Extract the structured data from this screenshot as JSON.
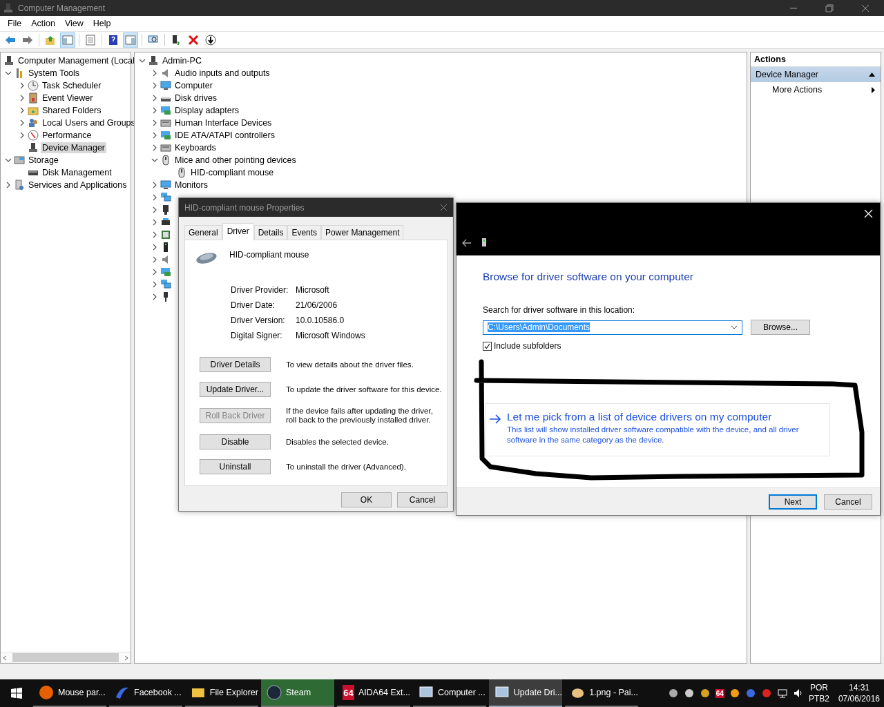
{
  "window": {
    "title": "Computer Management"
  },
  "menu": [
    "File",
    "Action",
    "View",
    "Help"
  ],
  "toolbar": [
    {
      "pressed": false
    },
    {
      "pressed": false
    },
    {
      "pressed": false
    },
    {
      "pressed": true
    },
    {
      "pressed": false
    },
    {
      "pressed": false
    },
    {
      "pressed": true
    },
    {
      "pressed": false
    },
    {
      "pressed": false
    },
    {
      "pressed": false
    },
    {
      "pressed": false
    }
  ],
  "console_tree": {
    "root": "Computer Management (Local",
    "children": [
      {
        "label": "System Tools",
        "expanded": true,
        "selected": false,
        "children": [
          {
            "label": "Task Scheduler",
            "expanded": false,
            "selected": false
          },
          {
            "label": "Event Viewer",
            "expanded": false,
            "selected": false
          },
          {
            "label": "Shared Folders",
            "expanded": false,
            "selected": false
          },
          {
            "label": "Local Users and Groups",
            "expanded": false,
            "selected": false
          },
          {
            "label": "Performance",
            "expanded": false,
            "selected": false
          },
          {
            "label": "Device Manager",
            "selected": true
          }
        ]
      },
      {
        "label": "Storage",
        "expanded": true,
        "selected": false,
        "children": [
          {
            "label": "Disk Management",
            "selected": false
          }
        ]
      },
      {
        "label": "Services and Applications",
        "expanded": false,
        "selected": false
      }
    ]
  },
  "device_tree": {
    "root": "Admin-PC",
    "expanded": true,
    "children": [
      {
        "label": "Audio inputs and outputs",
        "expanded": false
      },
      {
        "label": "Computer",
        "expanded": false
      },
      {
        "label": "Disk drives",
        "expanded": false
      },
      {
        "label": "Display adapters",
        "expanded": false
      },
      {
        "label": "Human Interface Devices",
        "expanded": false
      },
      {
        "label": "IDE ATA/ATAPI controllers",
        "expanded": false
      },
      {
        "label": "Keyboards",
        "expanded": false
      },
      {
        "label": "Mice and other pointing devices",
        "expanded": true,
        "children": [
          {
            "label": "HID-compliant mouse"
          }
        ]
      },
      {
        "label": "Monitors",
        "expanded": false
      },
      {
        "expanded": false
      },
      {
        "expanded": false
      },
      {
        "expanded": false
      },
      {
        "expanded": false
      },
      {
        "expanded": false
      },
      {
        "expanded": false
      },
      {
        "expanded": false
      },
      {
        "expanded": false
      },
      {
        "expanded": false
      }
    ]
  },
  "actions": {
    "title": "Actions",
    "section": {
      "label": "Device Manager",
      "expanded": true
    },
    "items": [
      "More Actions"
    ]
  },
  "properties_dialog": {
    "title": "HID-compliant mouse Properties",
    "tabs": [
      {
        "label": "General",
        "selected": false
      },
      {
        "label": "Driver",
        "selected": true
      },
      {
        "label": "Details",
        "selected": false
      },
      {
        "label": "Events",
        "selected": false
      },
      {
        "label": "Power Management",
        "selected": false
      }
    ],
    "device_name": "HID-compliant mouse",
    "info": [
      {
        "label": "Driver Provider:",
        "value": "Microsoft"
      },
      {
        "label": "Driver Date:",
        "value": "21/06/2006"
      },
      {
        "label": "Driver Version:",
        "value": "10.0.10586.0"
      },
      {
        "label": "Digital Signer:",
        "value": "Microsoft Windows"
      }
    ],
    "actions": [
      {
        "button": "Driver Details",
        "disabled": false,
        "description": "To view details about the driver files."
      },
      {
        "button": "Update Driver...",
        "disabled": false,
        "description": "To update the driver software for this device."
      },
      {
        "button": "Roll Back Driver",
        "disabled": true,
        "description": "If the device fails after updating the driver, roll back to the previously installed driver."
      },
      {
        "button": "Disable",
        "disabled": false,
        "description": "Disables the selected device."
      },
      {
        "button": "Uninstall",
        "disabled": false,
        "description": "To uninstall the driver (Advanced)."
      }
    ],
    "buttons": [
      "OK",
      "Cancel"
    ]
  },
  "update_wizard": {
    "heading": "Browse for driver software on your computer",
    "location_label": "Search for driver software in this location:",
    "location_value": "C:\\Users\\Admin\\Documents",
    "browse_button": "Browse...",
    "include_subfolders": {
      "label": "Include subfolders",
      "checked": true
    },
    "pick_option": {
      "title": "Let me pick from a list of device drivers on my computer",
      "description": "This list will show installed driver software compatible with the device, and all driver software in the same category as the device."
    },
    "buttons": [
      {
        "label": "Next",
        "default": true
      },
      {
        "label": "Cancel",
        "default": false
      }
    ]
  },
  "taskbar": {
    "items": [
      {
        "label": "Mouse par...",
        "selected": false,
        "flashing": false
      },
      {
        "label": "Facebook ...",
        "selected": false,
        "flashing": false
      },
      {
        "label": "File Explorer",
        "selected": false,
        "flashing": false
      },
      {
        "label": "Steam",
        "selected": false,
        "flashing": true
      },
      {
        "label": "AIDA64 Ext...",
        "selected": false,
        "flashing": false,
        "icon_text": "64"
      },
      {
        "label": "Computer ...",
        "selected": false,
        "flashing": false
      },
      {
        "label": "Update Dri...",
        "selected": true,
        "flashing": false
      },
      {
        "label": "1.png - Pai...",
        "selected": false,
        "flashing": false
      }
    ],
    "tray_badge": "64",
    "language": "POR",
    "layout": "PTB2",
    "time": "14:31",
    "date": "07/06/2016"
  }
}
